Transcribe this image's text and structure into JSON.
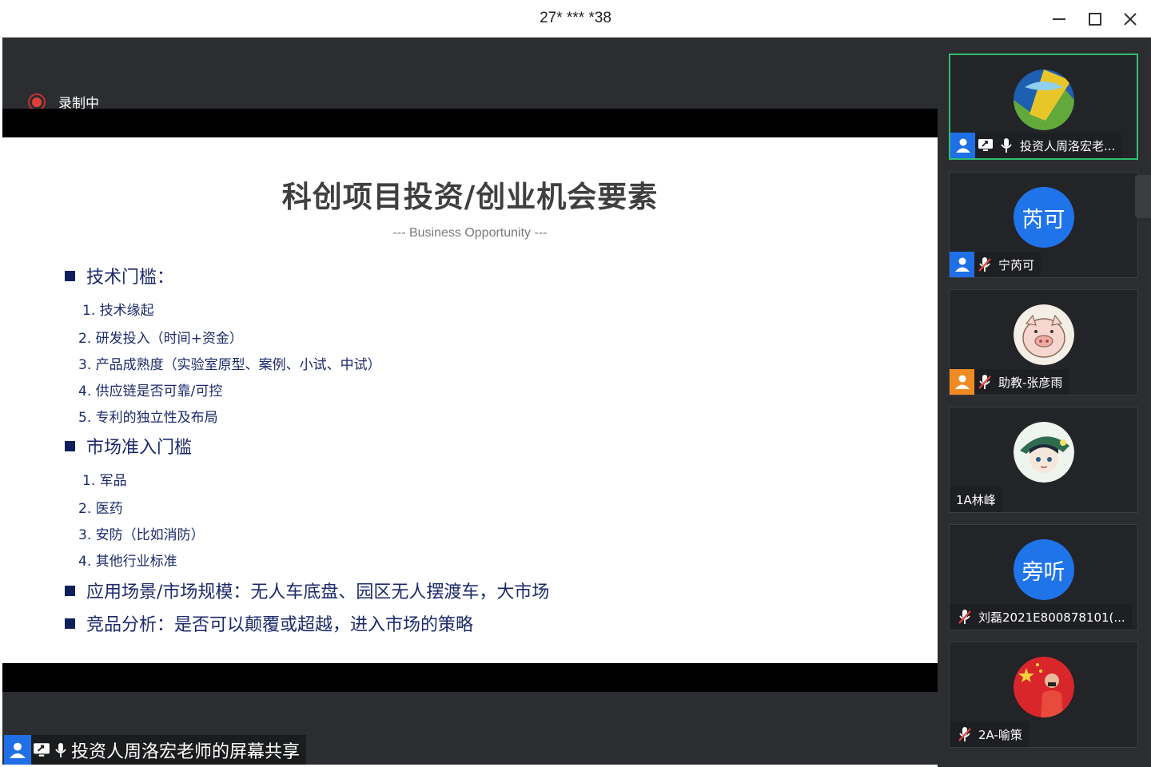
{
  "window": {
    "title": "27* *** *38",
    "minimize_icon": "minimize-icon",
    "maximize_icon": "maximize-icon",
    "close_icon": "close-icon"
  },
  "recording": {
    "label": "录制中",
    "color": "#e0403c"
  },
  "slide": {
    "title": "科创项目投资/创业机会要素",
    "subtitle": "--- Business Opportunity ---",
    "sections": [
      {
        "heading": "技术门槛：",
        "items": [
          "1. 技术缘起",
          "2.   研发投入（时间+资金）",
          "3.   产品成熟度（实验室原型、案例、小试、中试）",
          "4.   供应链是否可靠/可控",
          "5.   专利的独立性及布局"
        ]
      },
      {
        "heading": "市场准入门槛",
        "items": [
          "1. 军品",
          "2. 医药",
          "3. 安防（比如消防）",
          "4. 其他行业标准"
        ]
      },
      {
        "heading": "应用场景/市场规模：无人车底盘、园区无人摆渡车，大市场",
        "items": []
      },
      {
        "heading": "竞品分析：是否可以颠覆或超越，进入市场的策略",
        "items": []
      }
    ]
  },
  "participants": [
    {
      "name": "投资人周洛宏老...",
      "avatar": "logo-image",
      "badge": "blue",
      "screen_share": true,
      "mic": "on",
      "active": true
    },
    {
      "name": "宁芮可",
      "avatar_text": "芮可",
      "badge": "blue",
      "mic": "muted"
    },
    {
      "name": "助教-张彦雨",
      "avatar": "pig-image",
      "badge": "orange",
      "mic": "muted"
    },
    {
      "name": "1A林峰",
      "avatar": "anime-character-image"
    },
    {
      "name": "刘磊2021E800878101(...",
      "avatar_text": "旁听",
      "mic": "muted"
    },
    {
      "name": "2A-喻策",
      "avatar": "flag-person-image",
      "mic": "muted"
    }
  ],
  "share_label": {
    "text": "投资人周洛宏老师的屏幕共享"
  },
  "colors": {
    "accent": "#1f74ea",
    "active_border": "#2fbf71",
    "slide_text": "#1c2a6b",
    "dark_bg": "#2b2d30"
  }
}
